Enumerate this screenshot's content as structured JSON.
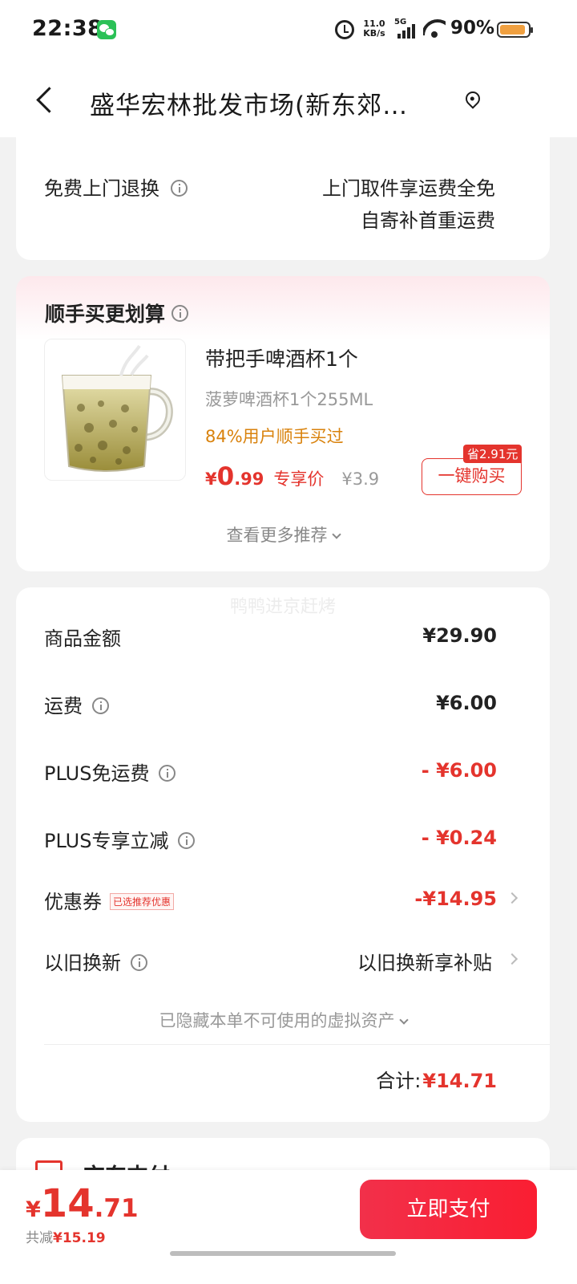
{
  "status_bar": {
    "time": "22:38",
    "net_speed_value": "11.0",
    "net_speed_unit": "KB/s",
    "network": "5G",
    "battery": "90%",
    "icons": [
      "wechat-icon",
      "alarm-icon",
      "signal-icon",
      "wifi-icon",
      "battery-icon"
    ]
  },
  "header": {
    "title": "盛华宏林批发市场(新东郊…",
    "icons": [
      "back-icon",
      "location-pin-icon"
    ]
  },
  "return_card": {
    "label": "免费上门退换",
    "line1": "上门取件享运费全免",
    "line2": "自寄补首重运费"
  },
  "upsell": {
    "title": "顺手买更划算",
    "product": {
      "name": "带把手啤酒杯1个",
      "spec": "菠萝啤酒杯1个255ML",
      "bought": "84%用户顺手买过",
      "price_symbol": "¥",
      "price_int": "0",
      "price_dec": ".99",
      "price_tag": "专享价",
      "original_price": "¥3.9",
      "save_badge": "省2.91元",
      "buy_label": "一键购买"
    },
    "more_label": "查看更多推荐"
  },
  "summary": {
    "watermark": "鸭鸭进京赶烤",
    "rows": [
      {
        "label": "商品金额",
        "value": "¥29.90"
      },
      {
        "label": "运费",
        "value": "¥6.00"
      },
      {
        "label": "PLUS免运费",
        "value": "- ¥6.00"
      },
      {
        "label": "PLUS专享立减",
        "value": "- ¥0.24"
      },
      {
        "label": "优惠券",
        "tag": "已选推荐优惠",
        "value": "-¥14.95"
      },
      {
        "label": "以旧换新",
        "value": "以旧换新享补贴"
      }
    ],
    "hidden_assets": "已隐藏本单不可使用的虚拟资产",
    "total_label": "合计:",
    "total_value": "¥14.71"
  },
  "pay_card": {
    "label": "京东支付"
  },
  "bottom_bar": {
    "price_symbol": "¥",
    "price_int": "14",
    "price_dec": ".71",
    "saved_label": "共减",
    "saved_value": "¥15.19",
    "pay_button": "立即支付"
  },
  "colors": {
    "accent_red": "#e4342d",
    "orange": "#d9820c",
    "background": "#f2f2f2"
  }
}
